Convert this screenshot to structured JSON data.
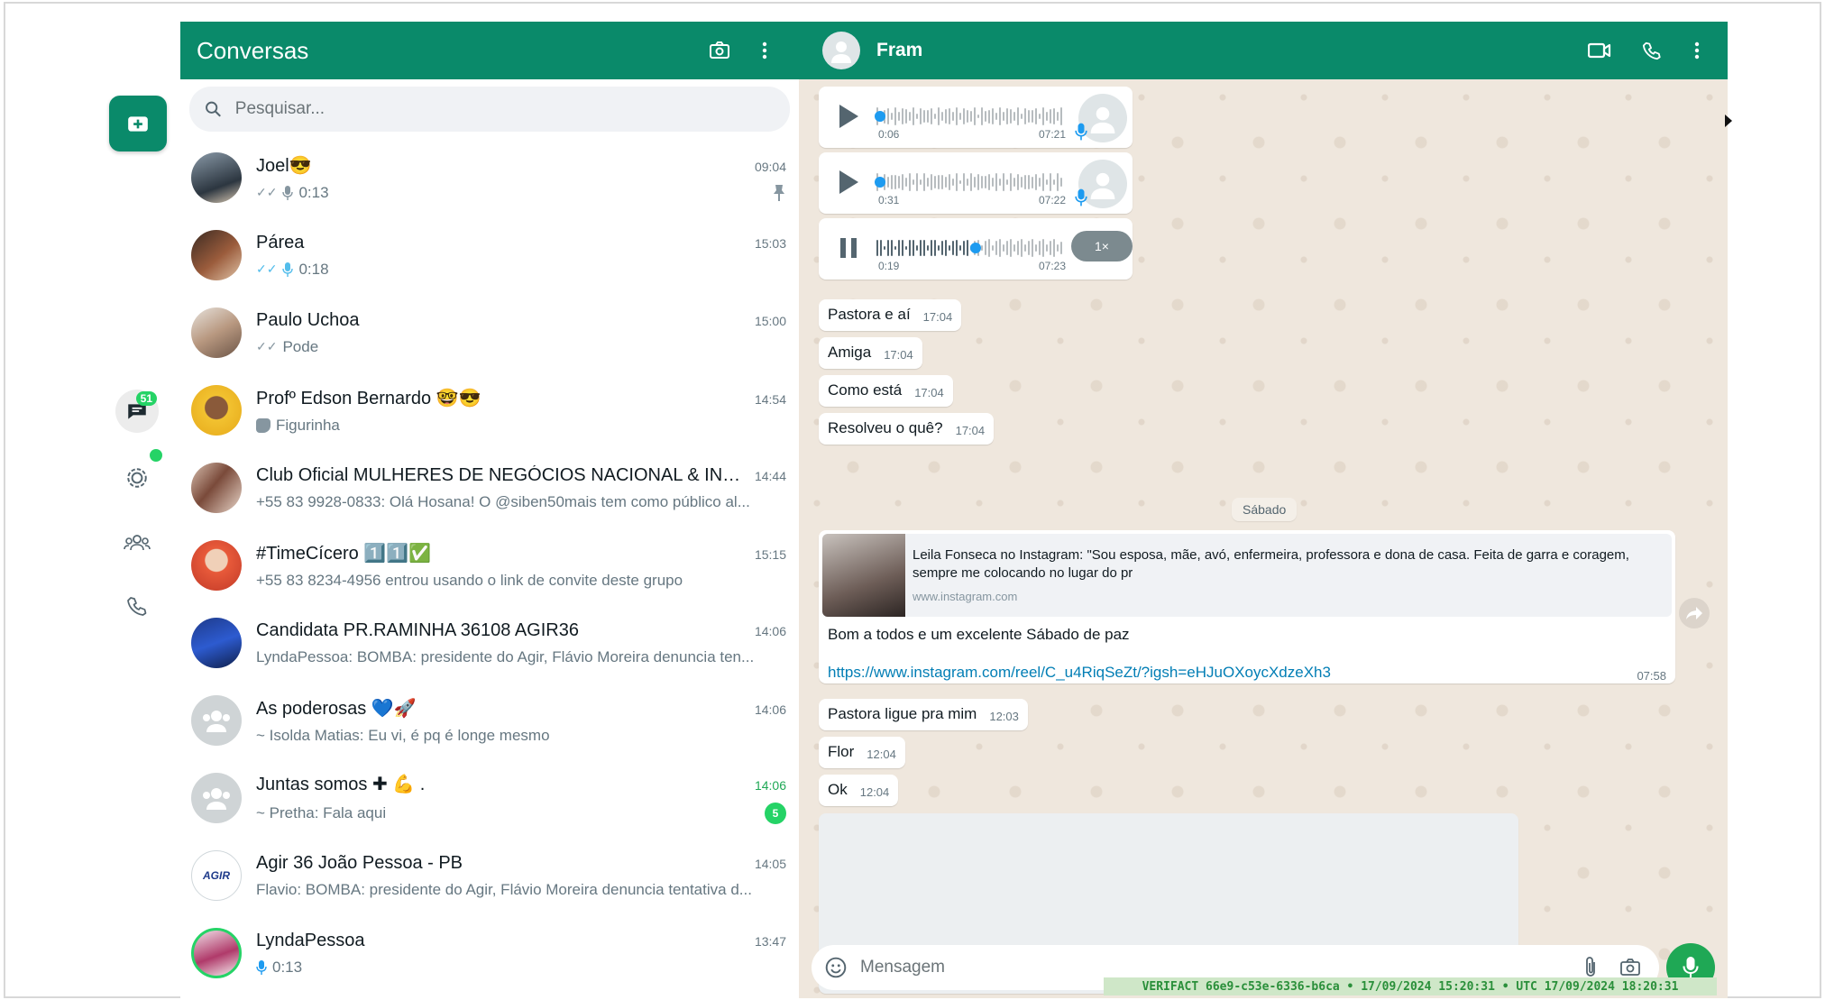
{
  "colors": {
    "brand": "#0a8a6a",
    "accent_green": "#25d366",
    "link": "#027eb5"
  },
  "left_rail": {
    "new_chat_icon": "new-chat-icon",
    "chats_badge": "51",
    "icons": [
      "chats-icon",
      "status-icon",
      "communities-icon",
      "calls-icon"
    ]
  },
  "list": {
    "title": "Conversas",
    "search_placeholder": "Pesquisar...",
    "chats": [
      {
        "name": "Joel😎",
        "time": "09:04",
        "preview": "0:13",
        "pinned": true
      },
      {
        "name": "Párea",
        "time": "15:03",
        "preview": "0:18"
      },
      {
        "name": "Paulo Uchoa",
        "time": "15:00",
        "preview": "Pode"
      },
      {
        "name": "Profº Edson Bernardo 🤓😎",
        "time": "14:54",
        "preview": "Figurinha"
      },
      {
        "name": "Club Oficial MULHERES DE NEGÓCIOS NACIONAL & INT...",
        "time": "14:44",
        "preview": "+55 83 9928-0833: Olá Hosana! O @siben50mais tem como público al..."
      },
      {
        "name": "#TimeCícero 1️⃣1️⃣✅",
        "time": "15:15",
        "preview": "+55 83 8234-4956 entrou usando o link de convite deste grupo"
      },
      {
        "name": "Candidata PR.RAMINHA 36108 AGIR36",
        "time": "14:06",
        "preview": "LyndaPessoa: BOMBA: presidente do Agir, Flávio Moreira denuncia ten..."
      },
      {
        "name": "As poderosas 💙🚀",
        "time": "14:06",
        "preview": "~ Isolda Matias: Eu vi, é pq é longe mesmo"
      },
      {
        "name": "Juntas somos ✚ 💪 .",
        "time": "14:06",
        "preview": "~ Pretha: Fala aqui",
        "unread": "5"
      },
      {
        "name": "Agir 36 João Pessoa - PB",
        "time": "14:05",
        "preview": "Flavio: BOMBA: presidente do Agir, Flávio Moreira denuncia tentativa d..."
      },
      {
        "name": "LyndaPessoa",
        "time": "13:47",
        "preview": "0:13"
      }
    ]
  },
  "chat": {
    "contact": "Fram",
    "audios": [
      {
        "elapsed": "0:06",
        "time": "07:21"
      },
      {
        "elapsed": "0:31",
        "time": "07:22"
      },
      {
        "elapsed": "0:19",
        "time": "07:23",
        "speed": "1×"
      }
    ],
    "messages_a": [
      {
        "text": "Pastora e aí",
        "time": "17:04"
      },
      {
        "text": "Amiga",
        "time": "17:04"
      },
      {
        "text": "Como está",
        "time": "17:04"
      },
      {
        "text": "Resolveu o quê?",
        "time": "17:04"
      }
    ],
    "date_divider": "Sábado",
    "link_message": {
      "preview_title": "Leila Fonseca no Instagram: \"Sou esposa, mãe, avó, enfermeira, professora e dona de casa. Feita de garra e coragem, sempre me colocando no lugar do pr",
      "preview_domain": "www.instagram.com",
      "caption": "Bom a todos e um excelente Sábado de paz",
      "url": "https://www.instagram.com/reel/C_u4RiqSeZt/?igsh=eHJuOXoycXdzeXh3",
      "time": "07:58"
    },
    "messages_b": [
      {
        "text": "Pastora ligue pra mim",
        "time": "12:03"
      },
      {
        "text": "Flor",
        "time": "12:04"
      },
      {
        "text": "Ok",
        "time": "12:04"
      }
    ],
    "composer_placeholder": "Mensagem"
  },
  "verifact": "VERIFACT 66e9-c53e-6336-b6ca • 17/09/2024 15:20:31 • UTC 17/09/2024 18:20:31"
}
